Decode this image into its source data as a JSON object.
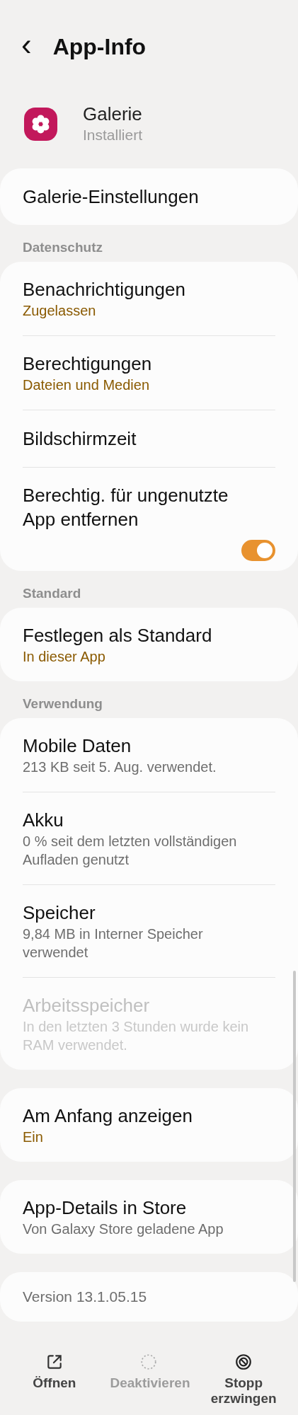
{
  "header": {
    "back": "‹",
    "title": "App-Info"
  },
  "app": {
    "name": "Galerie",
    "status": "Installiert"
  },
  "sections": [
    {
      "cards": [
        {
          "items": [
            {
              "kind": "plain",
              "title": "Galerie-Einstellungen",
              "disabled": false
            }
          ]
        }
      ]
    },
    {
      "heading": "Datenschutz",
      "cards": [
        {
          "items": [
            {
              "kind": "status",
              "title": "Benachrichtigungen",
              "subtitle": "Zugelassen",
              "disabled": false
            },
            {
              "kind": "status",
              "title": "Berechtigungen",
              "subtitle": "Dateien und Medien",
              "disabled": false
            },
            {
              "kind": "plain",
              "title": "Bildschirmzeit",
              "disabled": false
            },
            {
              "kind": "toggle",
              "title": "Berechtig. für ungenutzte App entfernen",
              "on": true,
              "disabled": false
            }
          ]
        }
      ]
    },
    {
      "heading": "Standard",
      "cards": [
        {
          "items": [
            {
              "kind": "status",
              "title": "Festlegen als Standard",
              "subtitle": "In dieser App",
              "disabled": false
            }
          ]
        }
      ]
    },
    {
      "heading": "Verwendung",
      "cards": [
        {
          "items": [
            {
              "kind": "description",
              "title": "Mobile Daten",
              "subtitle": "213 KB seit 5. Aug. verwendet.",
              "disabled": false
            },
            {
              "kind": "description",
              "title": "Akku",
              "subtitle": "0 % seit dem letzten vollständigen Aufladen genutzt",
              "disabled": false
            },
            {
              "kind": "description",
              "title": "Speicher",
              "subtitle": "9,84 MB in Interner Speicher verwendet",
              "disabled": false
            },
            {
              "kind": "description",
              "title": "Arbeitsspeicher",
              "subtitle": "In den letzten 3 Stunden wurde kein RAM verwendet.",
              "disabled": true
            }
          ]
        },
        {
          "items": [
            {
              "kind": "status",
              "title": "Am Anfang anzeigen",
              "subtitle": "Ein",
              "disabled": false
            }
          ]
        },
        {
          "items": [
            {
              "kind": "description",
              "title": "App-Details in Store",
              "subtitle": "Von Galaxy Store geladene App",
              "disabled": false
            }
          ]
        },
        {
          "items": [
            {
              "kind": "version",
              "title": "Version 13.1.05.15",
              "disabled": false
            }
          ]
        }
      ]
    }
  ],
  "actions": [
    {
      "kind": "open",
      "label": "Öffnen",
      "disabled": false
    },
    {
      "kind": "disable",
      "label": "Deaktivieren",
      "disabled": true
    },
    {
      "kind": "stop",
      "label": "Stopp erzwingen",
      "disabled": false
    }
  ]
}
